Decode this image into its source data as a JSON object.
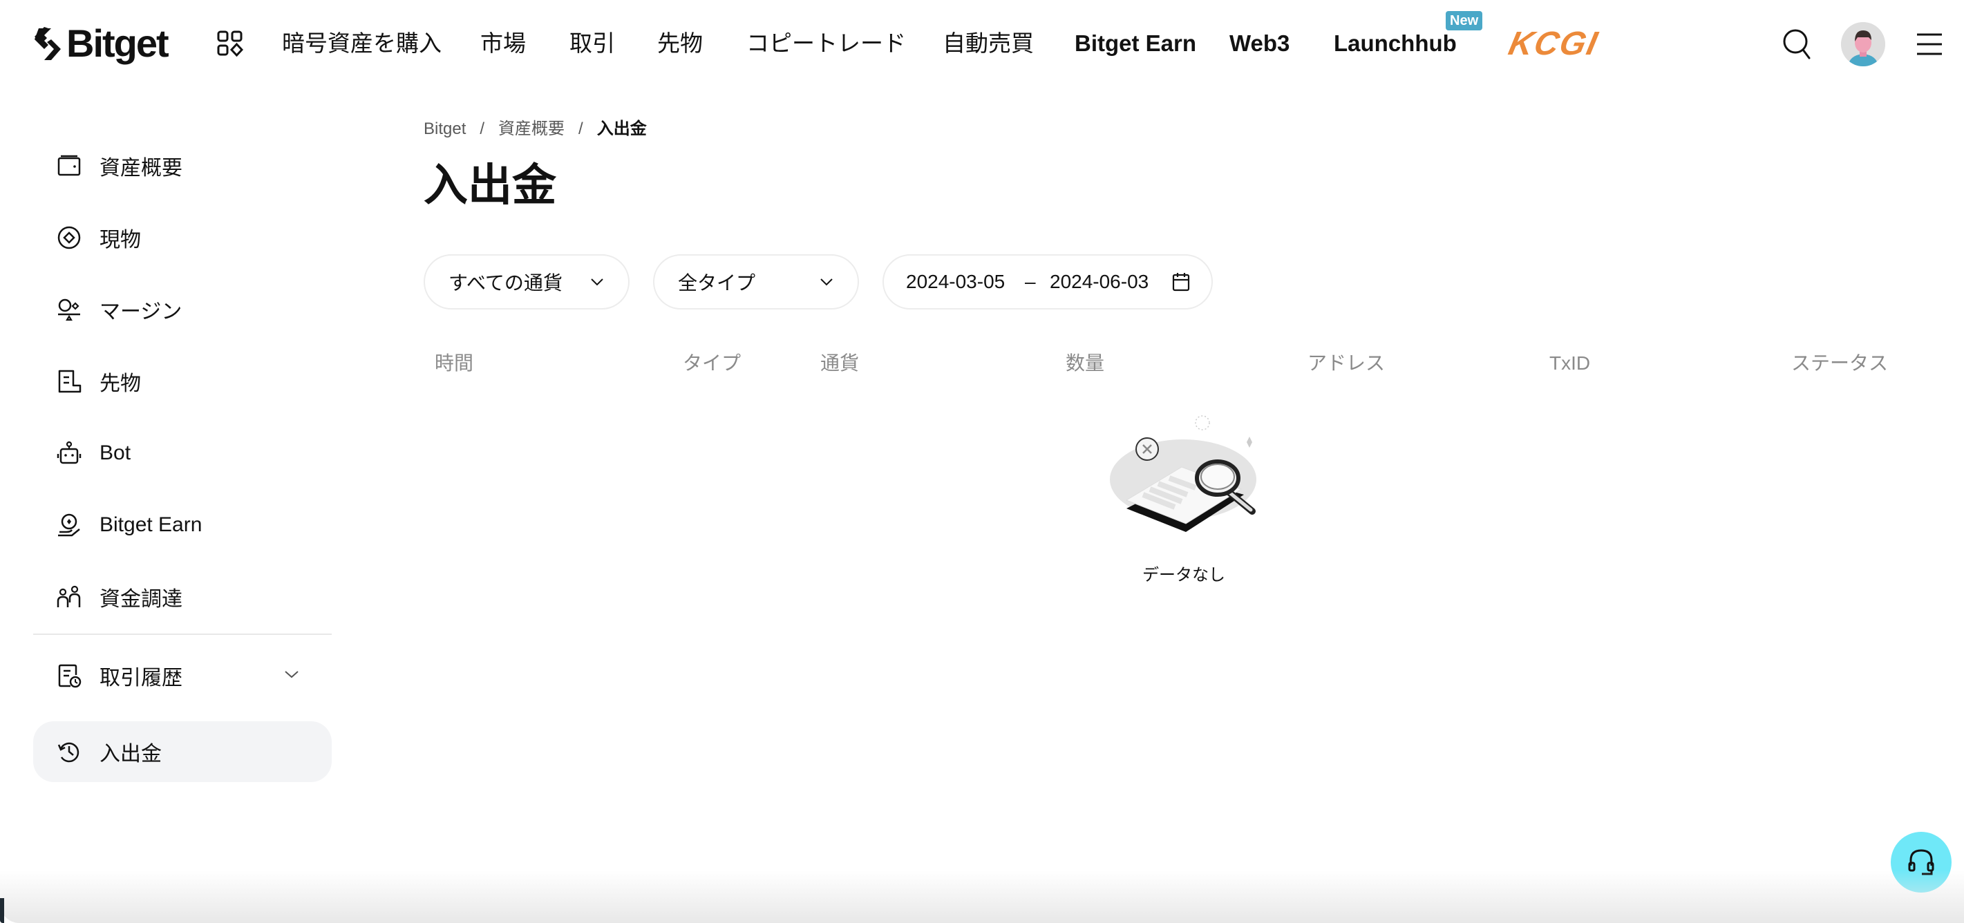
{
  "header": {
    "logo_text": "Bitget",
    "nav": [
      {
        "label": "暗号資産を購入"
      },
      {
        "label": "市場"
      },
      {
        "label": "取引"
      },
      {
        "label": "先物"
      },
      {
        "label": "コピートレード"
      },
      {
        "label": "自動売買"
      },
      {
        "label": "Bitget Earn"
      },
      {
        "label": "Web3"
      },
      {
        "label": "Launchhub"
      }
    ],
    "new_badge": "New",
    "partner_logo": "KCGI",
    "icons": [
      "apps-icon",
      "search-icon",
      "avatar",
      "menu-icon"
    ]
  },
  "sidebar": {
    "items": [
      {
        "label": "資産概要",
        "icon": "wallet-icon"
      },
      {
        "label": "現物",
        "icon": "spot-icon"
      },
      {
        "label": "マージン",
        "icon": "margin-icon"
      },
      {
        "label": "先物",
        "icon": "futures-icon"
      },
      {
        "label": "Bot",
        "icon": "bot-icon"
      },
      {
        "label": "Bitget Earn",
        "icon": "earn-icon"
      },
      {
        "label": "資金調達",
        "icon": "people-icon"
      },
      {
        "label": "取引履歴",
        "icon": "history-doc-icon",
        "expandable": true
      },
      {
        "label": "入出金",
        "icon": "clock-history-icon",
        "active": true
      }
    ]
  },
  "breadcrumb": {
    "items": [
      "Bitget",
      "資産概要",
      "入出金"
    ],
    "separator": "/"
  },
  "page": {
    "title": "入出金"
  },
  "filters": {
    "currency": "すべての通貨",
    "type": "全タイプ",
    "date_from": "2024-03-05",
    "date_sep": "–",
    "date_to": "2024-06-03"
  },
  "table": {
    "columns": [
      "時間",
      "タイプ",
      "通貨",
      "数量",
      "アドレス",
      "TxID",
      "ステータス"
    ],
    "rows": []
  },
  "empty_state": {
    "text": "データなし",
    "icon": "no-data-illustration"
  },
  "support": {
    "icon": "headset-icon"
  },
  "colors": {
    "text": "#121212",
    "muted": "#8a8a8a",
    "badge": "#4aa8c8",
    "kcgi": "#ec8a3a",
    "support": "#6fe8f8",
    "active_bg": "#f3f4f6"
  }
}
